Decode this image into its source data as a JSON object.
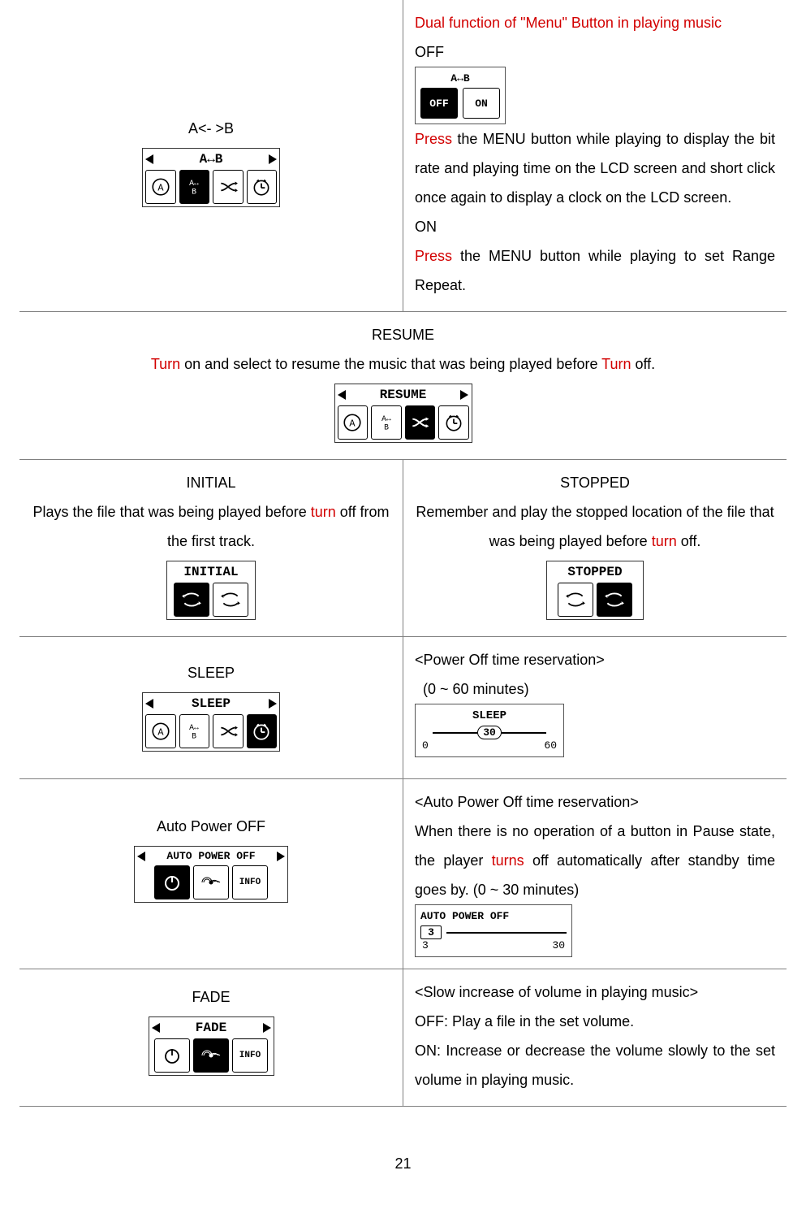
{
  "row1": {
    "left_title": "A<- >B",
    "dual_title": "Dual function of \"Menu\" Button in playing music",
    "off_label": "OFF",
    "off_box_off": "OFF",
    "off_box_on": "ON",
    "off_press_word": "Press",
    "off_desc": " the MENU button while playing to display the bit rate and playing time on the LCD screen and short click once again to display a clock on the LCD screen.",
    "on_label": "ON",
    "on_press_word": "Press",
    "on_desc": " the MENU button while playing to set Range Repeat.",
    "lcd_ab_header": "A↔B"
  },
  "row2": {
    "title": "RESUME",
    "turn_word": "Turn",
    "desc1": " on and select to resume the music that was being played before ",
    "turn_off": "Turn",
    "desc2": " off.",
    "lcd_header": "RESUME"
  },
  "row3": {
    "left_title": "INITIAL",
    "left_desc1": "Plays the file that was being played before ",
    "left_turn": "turn",
    "left_desc2": " off from the first track.",
    "left_lcd": "INITIAL",
    "right_title": "STOPPED",
    "right_desc1": "Remember and play the stopped location of the file that was being played before ",
    "right_turn": "turn",
    "right_desc2": " off.",
    "right_lcd": "STOPPED"
  },
  "row4": {
    "left_title": "SLEEP",
    "left_lcd": "SLEEP",
    "right_title": "<Power Off time reservation>",
    "right_range": "  (0 ~ 60 minutes)",
    "lcd_header": "SLEEP",
    "lcd_value": "30",
    "lcd_min": "0",
    "lcd_max": "60"
  },
  "row5": {
    "left_title": "Auto Power OFF",
    "left_lcd": "AUTO POWER OFF",
    "right_title": "<Auto Power Off time reservation>",
    "right_desc1": "When there is no operation of a button in Pause state, the player ",
    "right_turn": "turns",
    "right_desc2": " off automatically after standby time goes by. (0 ~ 30 minutes)",
    "lcd_header": "AUTO POWER OFF",
    "lcd_value": "3",
    "lcd_min": "3",
    "lcd_max": "30"
  },
  "row6": {
    "left_title": "FADE",
    "left_lcd": "FADE",
    "right_title": "<Slow increase of volume in playing music>",
    "right_off": "OFF: Play a file in the set volume.",
    "right_on": "ON: Increase or decrease the volume slowly to the set volume in playing music."
  },
  "page_number": "21"
}
